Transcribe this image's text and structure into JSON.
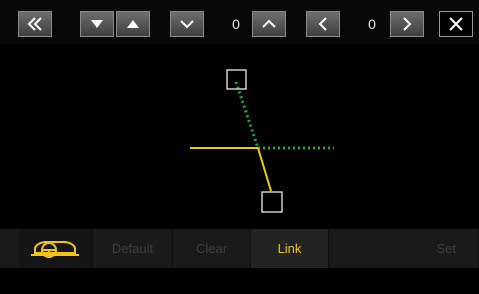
{
  "toolbar": {
    "back_icon": "double-chevron-left-icon",
    "vertical_value": "0",
    "horizontal_value": "0",
    "close_icon": "close-icon"
  },
  "guide": {
    "solid_color": "#e6d200",
    "dotted_color": "#1fa83a",
    "marker_color": "#ffffff"
  },
  "bottom_tabs": {
    "car_icon": "steering-wheel-car-icon",
    "default_label": "Default",
    "clear_label": "Clear",
    "link_label": "Link",
    "set_label": "Set",
    "active_color": "#f2c21a"
  }
}
